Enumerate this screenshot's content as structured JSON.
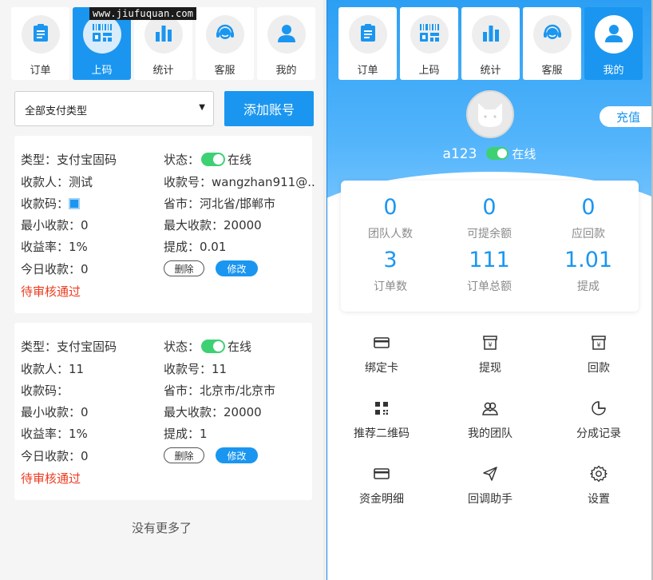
{
  "watermark": "www.jiufuquan.com",
  "left_nav": [
    {
      "label": "订单",
      "icon": "order-icon",
      "active": false
    },
    {
      "label": "上码",
      "icon": "barcode-icon",
      "active": true
    },
    {
      "label": "统计",
      "icon": "chart-icon",
      "active": false
    },
    {
      "label": "客服",
      "icon": "headset-icon",
      "active": false
    },
    {
      "label": "我的",
      "icon": "user-icon",
      "active": false
    }
  ],
  "right_nav": [
    {
      "label": "订单",
      "icon": "order-icon",
      "active": false
    },
    {
      "label": "上码",
      "icon": "barcode-icon",
      "active": false
    },
    {
      "label": "统计",
      "icon": "chart-icon",
      "active": false
    },
    {
      "label": "客服",
      "icon": "headset-icon",
      "active": false
    },
    {
      "label": "我的",
      "icon": "user-icon",
      "active": true
    }
  ],
  "filter": {
    "selected": "全部支付类型"
  },
  "add_button": "添加账号",
  "cards": [
    {
      "type": "类型：支付宝固码",
      "status_label": "状态：",
      "status_text": "在线",
      "payee": "收款人：测试",
      "account": "收款号：wangzhan911@..",
      "qr_label": "收款码：",
      "region": "省市：河北省/邯郸市",
      "min": "最小收款：0",
      "max": "最大收款：20000",
      "rate": "收益率：1%",
      "commission": "提成：0.01",
      "today": "今日收款：0",
      "delete": "删除",
      "edit": "修改",
      "pending": "待审核通过"
    },
    {
      "type": "类型：支付宝固码",
      "status_label": "状态：",
      "status_text": "在线",
      "payee": "收款人：11",
      "account": "收款号：11",
      "qr_label": "收款码：",
      "region": "省市：北京市/北京市",
      "min": "最小收款：0",
      "max": "最大收款：20000",
      "rate": "收益率：1%",
      "commission": "提成：1",
      "today": "今日收款：0",
      "delete": "删除",
      "edit": "修改",
      "pending": "待审核通过"
    }
  ],
  "no_more": "没有更多了",
  "profile": {
    "recharge": "充值",
    "username": "a123",
    "status": "在线"
  },
  "stats": [
    {
      "value": "0",
      "label": "团队人数"
    },
    {
      "value": "0",
      "label": "可提余额"
    },
    {
      "value": "0",
      "label": "应回款"
    },
    {
      "value": "3",
      "label": "订单数"
    },
    {
      "value": "111",
      "label": "订单总额"
    },
    {
      "value": "1.01",
      "label": "提成"
    }
  ],
  "menu": [
    {
      "label": "绑定卡",
      "icon": "card-icon"
    },
    {
      "label": "提现",
      "icon": "withdraw-icon"
    },
    {
      "label": "回款",
      "icon": "repay-icon"
    },
    {
      "label": "推荐二维码",
      "icon": "qrcode-icon"
    },
    {
      "label": "我的团队",
      "icon": "team-icon"
    },
    {
      "label": "分成记录",
      "icon": "pie-icon"
    },
    {
      "label": "资金明细",
      "icon": "wallet-icon"
    },
    {
      "label": "回调助手",
      "icon": "send-icon"
    },
    {
      "label": "设置",
      "icon": "settings-icon"
    }
  ],
  "colors": {
    "primary": "#1a96f0",
    "online": "#3ed173",
    "pending": "#ee3a1e"
  }
}
